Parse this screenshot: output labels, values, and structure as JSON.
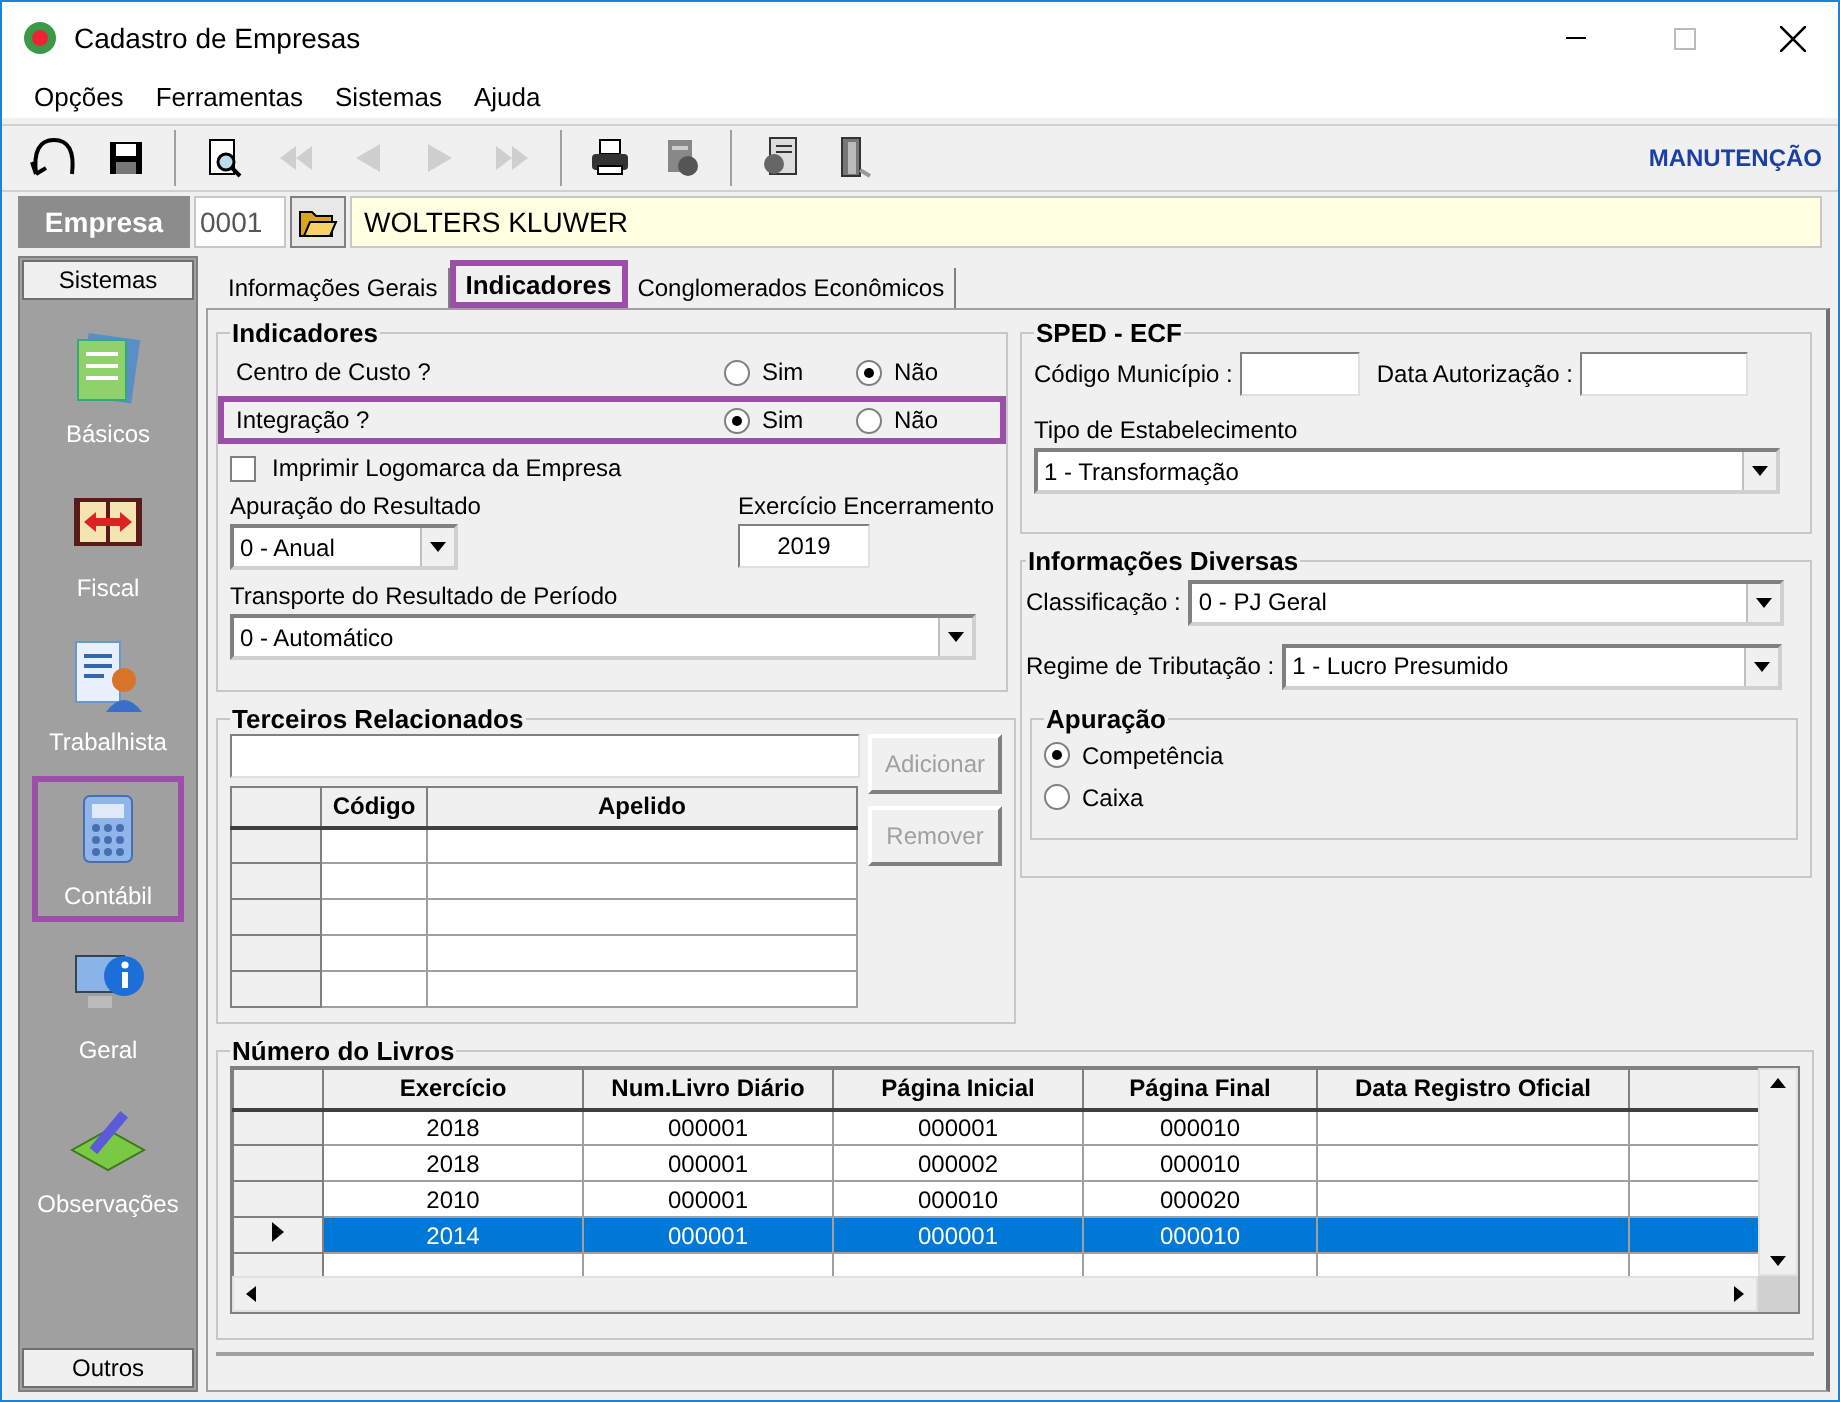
{
  "window": {
    "title": "Cadastro de Empresas"
  },
  "menu": [
    "Opções",
    "Ferramentas",
    "Sistemas",
    "Ajuda"
  ],
  "toolbar": {
    "mode": "MANUTENÇÃO",
    "groups": [
      [
        {
          "kind": "undo",
          "disabled": false
        },
        {
          "kind": "save",
          "disabled": false
        }
      ],
      [
        {
          "kind": "preview",
          "disabled": false
        },
        {
          "kind": "first",
          "disabled": true
        },
        {
          "kind": "prev",
          "disabled": true
        },
        {
          "kind": "next",
          "disabled": true
        },
        {
          "kind": "last",
          "disabled": true
        }
      ],
      [
        {
          "kind": "print",
          "disabled": false
        },
        {
          "kind": "tool",
          "disabled": false
        }
      ],
      [
        {
          "kind": "report",
          "disabled": false
        },
        {
          "kind": "exit",
          "disabled": false
        }
      ]
    ]
  },
  "company": {
    "label": "Empresa",
    "code": "0001",
    "name": "WOLTERS KLUWER"
  },
  "sidebar": {
    "header": "Sistemas",
    "footer": "Outros",
    "items": [
      {
        "label": "Básicos",
        "highlighted": false
      },
      {
        "label": "Fiscal",
        "highlighted": false
      },
      {
        "label": "Trabalhista",
        "highlighted": false
      },
      {
        "label": "Contábil",
        "highlighted": true
      },
      {
        "label": "Geral",
        "highlighted": false
      },
      {
        "label": "Observações",
        "highlighted": false
      }
    ]
  },
  "tabs": [
    {
      "label": "Informações Gerais",
      "selected": false,
      "highlighted": false
    },
    {
      "label": "Indicadores",
      "selected": true,
      "highlighted": true
    },
    {
      "label": "Conglomerados Econômicos",
      "selected": false,
      "highlighted": false
    }
  ],
  "indicadores": {
    "title": "Indicadores",
    "questions": [
      {
        "label": "Centro de Custo ?",
        "highlighted": false,
        "options": [
          {
            "label": "Sim",
            "selected": false
          },
          {
            "label": "Não",
            "selected": true
          }
        ]
      },
      {
        "label": "Integração ?",
        "highlighted": true,
        "options": [
          {
            "label": "Sim",
            "selected": true
          },
          {
            "label": "Não",
            "selected": false
          }
        ]
      }
    ],
    "print_logo": {
      "label": "Imprimir Logomarca da Empresa",
      "checked": false
    },
    "apuracao": {
      "label": "Apuração do Resultado",
      "value": "0 - Anual"
    },
    "exercicio": {
      "label": "Exercício Encerramento",
      "value": "2019"
    },
    "transporte": {
      "label": "Transporte do Resultado de Período",
      "value": "0 - Automático"
    }
  },
  "terceiros": {
    "title": "Terceiros Relacionados",
    "columns": [
      "Código",
      "Apelido"
    ],
    "buttons": [
      {
        "label": "Adicionar",
        "disabled": true
      },
      {
        "label": "Remover",
        "disabled": true
      }
    ]
  },
  "sped": {
    "title": "SPED - ECF",
    "codigo_label": "Código Município :",
    "data_label": "Data Autorização :",
    "tipo": {
      "label": "Tipo de Estabelecimento",
      "value": "1 - Transformação"
    }
  },
  "diversas": {
    "title": "Informações Diversas",
    "classificacao": {
      "label": "Classificação :",
      "value": "0 - PJ Geral"
    },
    "regime": {
      "label": "Regime de Tributação :",
      "value": "1 - Lucro Presumido"
    },
    "apuracao": {
      "title": "Apuração",
      "options": [
        {
          "label": "Competência",
          "selected": true
        },
        {
          "label": "Caixa",
          "selected": false
        }
      ]
    }
  },
  "livros": {
    "title": "Número do Livros",
    "columns": [
      "Exercício",
      "Num.Livro Diário",
      "Página Inicial",
      "Página Final",
      "Data Registro Oficial"
    ],
    "rows": [
      {
        "cells": [
          "2018",
          "000001",
          "000001",
          "000010"
        ],
        "selected": false
      },
      {
        "cells": [
          "2018",
          "000001",
          "000002",
          "000010"
        ],
        "selected": false
      },
      {
        "cells": [
          "2010",
          "000001",
          "000010",
          "000020"
        ],
        "selected": false
      },
      {
        "cells": [
          "2014",
          "000001",
          "000001",
          "000010"
        ],
        "selected": true
      }
    ]
  }
}
